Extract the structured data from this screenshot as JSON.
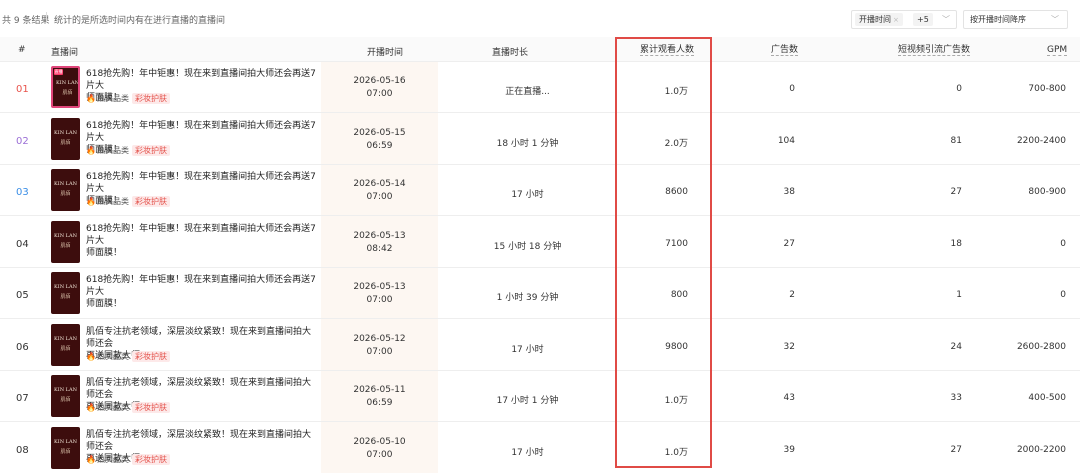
{
  "toolbar": {
    "result_count": "共 9 条结果",
    "hint": "统计的是所选时间内有在进行直播的直播间",
    "filter_chip": "开播时间",
    "filter_chip_close": "×",
    "filter_more": "+5",
    "sort_select": "按开播时间降序"
  },
  "table": {
    "headers": {
      "rank": "#",
      "room": "直播间",
      "start_time": "开播时间",
      "duration": "直播时长",
      "viewers": "累计观看人数",
      "ads": "广告数",
      "video_ads": "短视频引流广告数",
      "gpm": "GPM"
    },
    "rows": [
      {
        "rank": "01",
        "rank_color": "#e8534b",
        "live": true,
        "title_l1": "618抢先购！年中钜惠！现在来到直播间拍大师还会再送7片大",
        "title_l2": "师面膜！",
        "tag_hot": "热卖品类",
        "tag_cat": "彩妆护肤",
        "date": "2026-05-16",
        "time": "07:00",
        "duration": "正在直播...",
        "viewers": "1.0万",
        "ads": "0",
        "video_ads": "0",
        "gpm": "700-800"
      },
      {
        "rank": "02",
        "rank_color": "#9b6fd6",
        "live": false,
        "title_l1": "618抢先购！年中钜惠！现在来到直播间拍大师还会再送7片大",
        "title_l2": "师面膜！",
        "tag_hot": "热卖品类",
        "tag_cat": "彩妆护肤",
        "date": "2026-05-15",
        "time": "06:59",
        "duration": "18 小时 1 分钟",
        "viewers": "2.0万",
        "ads": "104",
        "video_ads": "81",
        "gpm": "2200-2400"
      },
      {
        "rank": "03",
        "rank_color": "#3a8ee6",
        "live": false,
        "title_l1": "618抢先购！年中钜惠！现在来到直播间拍大师还会再送7片大",
        "title_l2": "师面膜！",
        "tag_hot": "热卖品类",
        "tag_cat": "彩妆护肤",
        "date": "2026-05-14",
        "time": "07:00",
        "duration": "17 小时",
        "viewers": "8600",
        "ads": "38",
        "video_ads": "27",
        "gpm": "800-900"
      },
      {
        "rank": "04",
        "rank_color": "#333333",
        "live": false,
        "title_l1": "618抢先购！年中钜惠！现在来到直播间拍大师还会再送7片大",
        "title_l2": "师面膜！",
        "tag_hot": "",
        "tag_cat": "",
        "date": "2026-05-13",
        "time": "08:42",
        "duration": "15 小时 18 分钟",
        "viewers": "7100",
        "ads": "27",
        "video_ads": "18",
        "gpm": "0"
      },
      {
        "rank": "05",
        "rank_color": "#333333",
        "live": false,
        "title_l1": "618抢先购！年中钜惠！现在来到直播间拍大师还会再送7片大",
        "title_l2": "师面膜！",
        "tag_hot": "",
        "tag_cat": "",
        "date": "2026-05-13",
        "time": "07:00",
        "duration": "1 小时 39 分钟",
        "viewers": "800",
        "ads": "2",
        "video_ads": "1",
        "gpm": "0"
      },
      {
        "rank": "06",
        "rank_color": "#333333",
        "live": false,
        "title_l1": "肌佰专注抗老领域，深层淡纹紧致！现在来到直播间拍大师还会",
        "title_l2": "再送同款大师！",
        "tag_hot": "热卖品类",
        "tag_cat": "彩妆护肤",
        "date": "2026-05-12",
        "time": "07:00",
        "duration": "17 小时",
        "viewers": "9800",
        "ads": "32",
        "video_ads": "24",
        "gpm": "2600-2800"
      },
      {
        "rank": "07",
        "rank_color": "#333333",
        "live": false,
        "title_l1": "肌佰专注抗老领域，深层淡纹紧致！现在来到直播间拍大师还会",
        "title_l2": "再送同款大师！",
        "tag_hot": "热卖品类",
        "tag_cat": "彩妆护肤",
        "date": "2026-05-11",
        "time": "06:59",
        "duration": "17 小时 1 分钟",
        "viewers": "1.0万",
        "ads": "43",
        "video_ads": "33",
        "gpm": "400-500"
      },
      {
        "rank": "08",
        "rank_color": "#333333",
        "live": false,
        "title_l1": "肌佰专注抗老领域，深层淡纹紧致！现在来到直播间拍大师还会",
        "title_l2": "再送同款大师！",
        "tag_hot": "热卖品类",
        "tag_cat": "彩妆护肤",
        "date": "2026-05-10",
        "time": "07:00",
        "duration": "17 小时",
        "viewers": "1.0万",
        "ads": "39",
        "video_ads": "27",
        "gpm": "2000-2200"
      }
    ]
  },
  "thumb": {
    "brand": "KIN LAN",
    "sub": "肌佰",
    "live_tag": "直播"
  },
  "colors": {
    "highlight_box": "#e04b46",
    "tag_bg": "#fde9e9",
    "tag_text": "#e4544d",
    "fire": "#ff5a1f"
  },
  "icons": {
    "fire": "fire-icon",
    "chevron": "chevron-down-icon",
    "close": "close-icon"
  }
}
